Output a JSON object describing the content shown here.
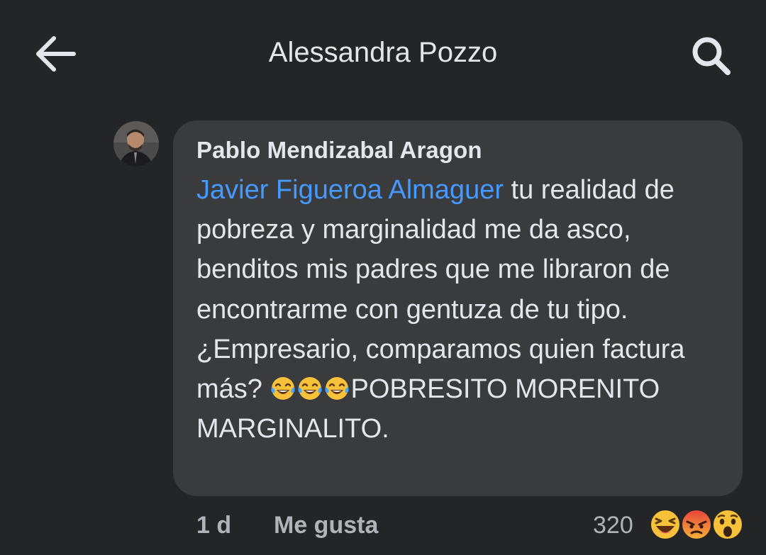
{
  "header": {
    "title": "Alessandra Pozzo",
    "back_icon": "arrow-left-icon",
    "search_icon": "search-icon"
  },
  "comment": {
    "author": "Pablo Mendizabal Aragon",
    "mention": "Javier Figueroa Almaguer",
    "text_part1": " tu realidad de pobreza y marginalidad me da asco, benditos mis padres que me libraron de encontrarme con gentuza de tu tipo.",
    "text_part2": "¿Empresario, comparamos quien factura más? ",
    "emojis": [
      "face-with-tears-of-joy-icon",
      "face-with-tears-of-joy-icon",
      "face-with-tears-of-joy-icon"
    ],
    "text_part3": "POBRESITO MORENITO MARGINALITO.",
    "timestamp": "1 d",
    "like_label": "Me gusta",
    "reaction_count": "320",
    "reaction_icons": [
      "haha-reaction-icon",
      "angry-reaction-icon",
      "wow-reaction-icon"
    ]
  },
  "colors": {
    "background": "#242526",
    "bubble": "#3a3b3c",
    "text": "#e4e6eb",
    "secondary_text": "#b0b3b8",
    "mention": "#4599ff"
  }
}
